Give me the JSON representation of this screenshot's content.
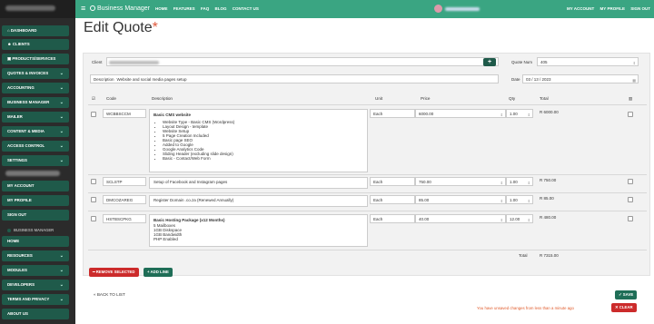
{
  "sidebar": {
    "items": [
      {
        "label": "DASHBOARD",
        "icon": "home-icon"
      },
      {
        "label": "CLIENTS",
        "icon": "users-icon"
      },
      {
        "label": "PRODUCTS/SERVICES",
        "icon": "box-icon"
      },
      {
        "label": "QUOTES & INVOICES",
        "chevron": true
      },
      {
        "label": "ACCOUNTING",
        "chevron": true
      },
      {
        "label": "BUSINESS MANAGER",
        "chevron": true
      },
      {
        "label": "MAILER",
        "chevron": true
      },
      {
        "label": "CONTENT & MEDIA",
        "chevron": true
      },
      {
        "label": "ACCESS CONTROL",
        "chevron": true
      },
      {
        "label": "SETTINGS",
        "chevron": true
      }
    ],
    "account_items": [
      "MY ACCOUNT",
      "MY PROFILE",
      "SIGN OUT"
    ],
    "section_header": "BUSINESS MANAGER",
    "section_items": [
      {
        "label": "HOME"
      },
      {
        "label": "RESOURCES",
        "chevron": true
      },
      {
        "label": "MODULES",
        "chevron": true
      },
      {
        "label": "DEVELOPERS",
        "chevron": true
      },
      {
        "label": "TERMS AND PRIVACY",
        "chevron": true
      },
      {
        "label": "ABOUT US"
      }
    ]
  },
  "topbar": {
    "brand": "Business Manager",
    "nav": [
      "HOME",
      "FEATURES",
      "FAQ",
      "BLOG",
      "CONTACT US"
    ],
    "right": [
      "MY ACCOUNT",
      "MY PROFILE",
      "SIGN OUT"
    ],
    "color": "#3aa582"
  },
  "page": {
    "title": "Edit Quote",
    "required_mark": "*"
  },
  "form": {
    "client_label": "Client",
    "add_client": "+",
    "quote_num_label": "Quote Num",
    "quote_num": "405",
    "description_label": "Description",
    "description": "Website and social media pages setup",
    "date_label": "Date",
    "date": "03 / 13 / 2023"
  },
  "table": {
    "headers": [
      "Code",
      "Description",
      "Unit",
      "Price",
      "Qty",
      "Total"
    ],
    "rows": [
      {
        "code": "WCBBSCCM",
        "desc_title": "Basic CMS website",
        "desc_bullets": [
          "Website Type - Basic CMS (Wordpress)",
          "Layout Design - template",
          "Website Setup",
          "5 Page Creation Included",
          "Basic page SEO",
          "Added to Google",
          "Google Analytics Code",
          "Sliding Header (excluding slide design)",
          "Basic - Contact/Web Form"
        ],
        "unit": "Each",
        "price": "6000.00",
        "qty": "1.00",
        "total": "R 6000.00"
      },
      {
        "code": "SCLSTP",
        "desc_plain": "Setup of Facebook and Instagram pages",
        "unit": "Each",
        "price": "750.00",
        "qty": "1.00",
        "total": "R 750.00"
      },
      {
        "code": "DMCOZAREG",
        "desc_plain": "Register Domain .co.za (Renewed Annually)",
        "unit": "Each",
        "price": "85.00",
        "qty": "1.00",
        "total": "R 85.00"
      },
      {
        "code": "HSTBSCPKG",
        "desc_title": "Basic Hosting Package (x12 Months)",
        "desc_lines": [
          "5 Mailboxes",
          "1GB Diskspace",
          "1GB Bandwidth",
          "PHP Enabled"
        ],
        "unit": "Each",
        "price": "40.00",
        "qty": "12.00",
        "total": "R 480.00"
      }
    ],
    "total_label": "Total",
    "grand_total": "R 7315.00"
  },
  "actions": {
    "remove_selected": "REMOVE SELECTED",
    "add_line": "ADD LINE",
    "back": "« BACK TO LIST",
    "save": "SAVE",
    "clear": "CLEAR",
    "unsaved_notice": "You have unsaved changes from less than a minute ago"
  }
}
